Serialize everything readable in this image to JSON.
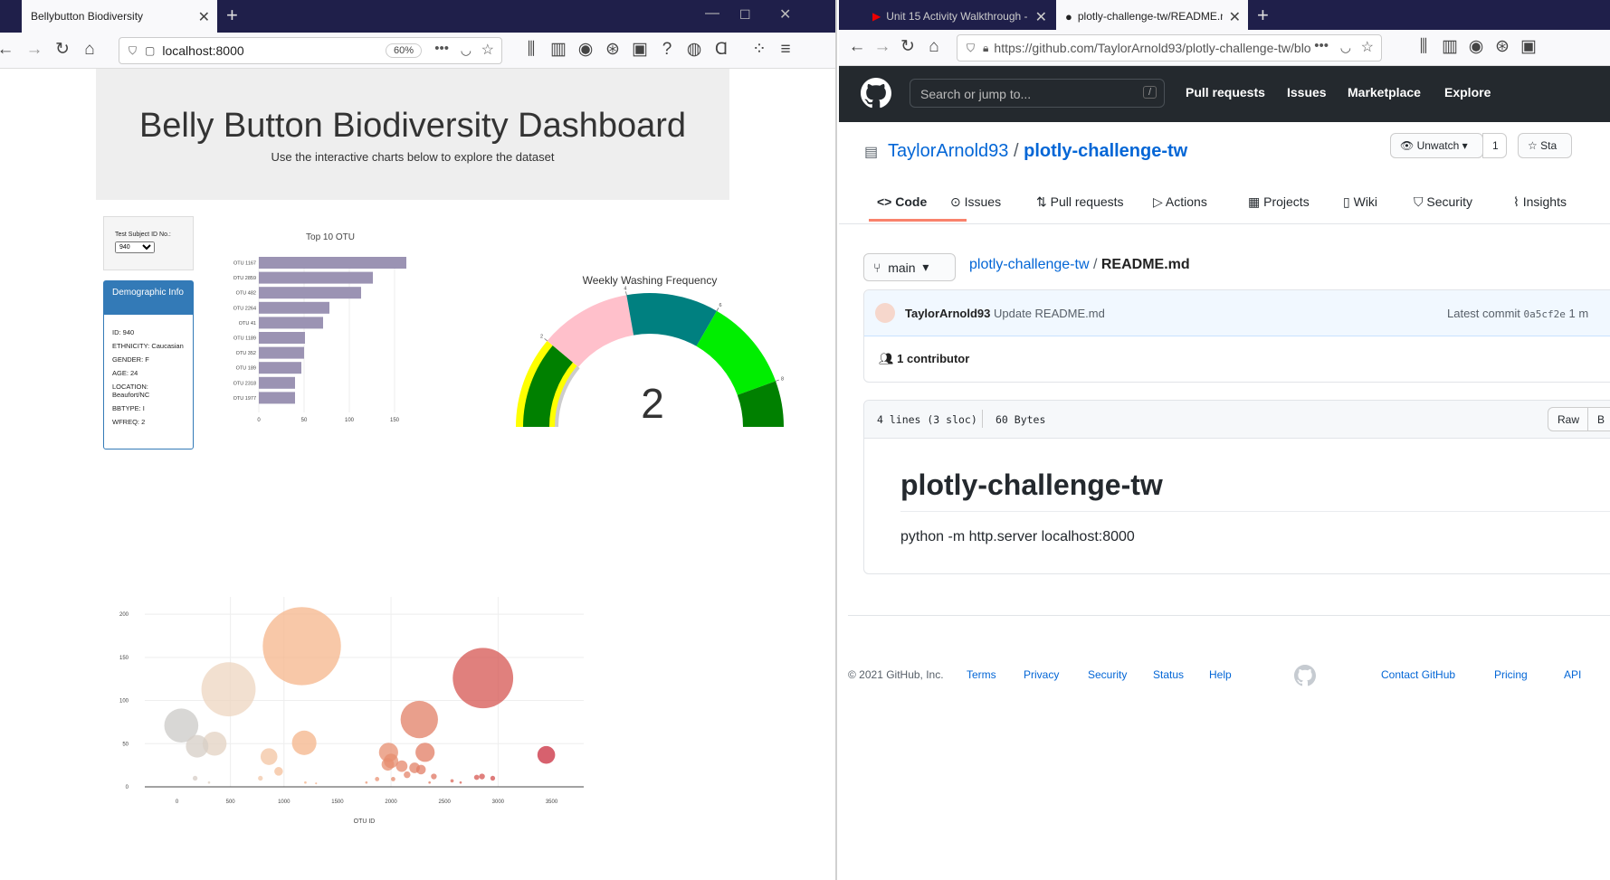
{
  "left_browser": {
    "tab_title": "Bellybutton Biodiversity",
    "url": "localhost:8000",
    "zoom": "60%"
  },
  "dashboard": {
    "title": "Belly Button Biodiversity Dashboard",
    "subtitle": "Use the interactive charts below to explore the dataset",
    "select_label": "Test Subject ID No.:",
    "selected_id": "940",
    "demo_title": "Demographic Info",
    "demographics": [
      "ID: 940",
      "ETHNICITY: Caucasian",
      "GENDER: F",
      "AGE: 24",
      "LOCATION: Beaufort/NC",
      "BBTYPE: I",
      "WFREQ: 2"
    ]
  },
  "chart_data": [
    {
      "type": "bar",
      "orientation": "horizontal",
      "title": "Top 10 OTU",
      "categories": [
        "OTU 1167",
        "OTU 2859",
        "OTU 482",
        "OTU 2264",
        "OTU 41",
        "OTU 1189",
        "OTU 352",
        "OTU 189",
        "OTU 2318",
        "OTU 1977"
      ],
      "values": [
        163,
        126,
        113,
        78,
        71,
        51,
        50,
        47,
        40,
        40
      ],
      "xlim": [
        0,
        175
      ],
      "xticks": [
        0,
        50,
        100,
        150
      ],
      "color": "#9b93b3"
    },
    {
      "type": "gauge",
      "title": "Weekly Washing Frequency",
      "value": 2,
      "range": [
        0,
        9
      ],
      "ticks": [
        0,
        2,
        4,
        6,
        8
      ],
      "bands": [
        {
          "from": 0,
          "to": 2,
          "color": "#008000",
          "border": "#ffff00"
        },
        {
          "from": 2,
          "to": 4,
          "color": "#ffc0cb"
        },
        {
          "from": 4,
          "to": 6,
          "color": "#008080"
        },
        {
          "from": 6,
          "to": 8,
          "color": "#00ee00"
        },
        {
          "from": 8,
          "to": 9,
          "color": "#008000"
        }
      ]
    },
    {
      "type": "scatter",
      "subtype": "bubble",
      "xlabel": "OTU ID",
      "xlim": [
        -300,
        3800
      ],
      "ylim": [
        0,
        220
      ],
      "xticks": [
        0,
        500,
        1000,
        1500,
        2000,
        2500,
        3000,
        3500
      ],
      "yticks": [
        0,
        50,
        100,
        150,
        200
      ],
      "points": [
        {
          "x": 41,
          "y": 71,
          "s": 71
        },
        {
          "x": 189,
          "y": 47,
          "s": 47
        },
        {
          "x": 352,
          "y": 50,
          "s": 50
        },
        {
          "x": 482,
          "y": 113,
          "s": 113
        },
        {
          "x": 1167,
          "y": 163,
          "s": 163
        },
        {
          "x": 1189,
          "y": 51,
          "s": 51
        },
        {
          "x": 2264,
          "y": 78,
          "s": 78
        },
        {
          "x": 2859,
          "y": 126,
          "s": 126
        },
        {
          "x": 2318,
          "y": 40,
          "s": 40
        },
        {
          "x": 1977,
          "y": 40,
          "s": 40
        },
        {
          "x": 3450,
          "y": 37,
          "s": 37
        },
        {
          "x": 860,
          "y": 35,
          "s": 35
        },
        {
          "x": 2000,
          "y": 30,
          "s": 30
        },
        {
          "x": 2100,
          "y": 24,
          "s": 24
        },
        {
          "x": 1970,
          "y": 26,
          "s": 26
        },
        {
          "x": 2220,
          "y": 22,
          "s": 22
        },
        {
          "x": 2280,
          "y": 20,
          "s": 20
        },
        {
          "x": 950,
          "y": 18,
          "s": 18
        },
        {
          "x": 2150,
          "y": 14,
          "s": 14
        },
        {
          "x": 2400,
          "y": 12,
          "s": 12
        },
        {
          "x": 2800,
          "y": 11,
          "s": 11
        },
        {
          "x": 2950,
          "y": 10,
          "s": 10
        },
        {
          "x": 1870,
          "y": 9,
          "s": 9
        },
        {
          "x": 2020,
          "y": 9,
          "s": 9
        },
        {
          "x": 2570,
          "y": 7,
          "s": 7
        },
        {
          "x": 2850,
          "y": 12,
          "s": 12
        },
        {
          "x": 170,
          "y": 10,
          "s": 10
        },
        {
          "x": 780,
          "y": 10,
          "s": 10
        },
        {
          "x": 300,
          "y": 5,
          "s": 5
        },
        {
          "x": 1200,
          "y": 5,
          "s": 5
        },
        {
          "x": 1300,
          "y": 4,
          "s": 4
        },
        {
          "x": 1770,
          "y": 5,
          "s": 5
        },
        {
          "x": 2360,
          "y": 5,
          "s": 5
        },
        {
          "x": 2650,
          "y": 5,
          "s": 5
        }
      ]
    }
  ],
  "right_browser": {
    "tab1_title": "Unit 15 Activity Walkthrough -",
    "tab2_title": "plotly-challenge-tw/README.m",
    "url": "https://github.com/TaylorArnold93/plotly-challenge-tw/blob/"
  },
  "github": {
    "search_placeholder": "Search or jump to...",
    "search_shortcut": "/",
    "nav": [
      "Pull requests",
      "Issues",
      "Marketplace",
      "Explore"
    ],
    "owner": "TaylorArnold93",
    "sep": "/",
    "repo": "plotly-challenge-tw",
    "unwatch": "Unwatch",
    "watch_count": "1",
    "star": "Sta",
    "tabs": [
      "Code",
      "Issues",
      "Pull requests",
      "Actions",
      "Projects",
      "Wiki",
      "Security",
      "Insights"
    ],
    "branch": "main",
    "path_repo": "plotly-challenge-tw",
    "path_file": "README.md",
    "commit_author": "TaylorArnold93",
    "commit_msg": "Update README.md",
    "latest_commit_label": "Latest commit",
    "commit_hash": "0a5cf2e",
    "commit_time": "1 m",
    "contributors": "1 contributor",
    "file_lines": "4 lines (3 sloc)",
    "file_size": "60 Bytes",
    "raw": "Raw",
    "blame_partial": "B",
    "readme_title": "plotly-challenge-tw",
    "readme_body": "python -m http.server localhost:8000",
    "footer_copy": "© 2021 GitHub, Inc.",
    "footer_left": [
      "Terms",
      "Privacy",
      "Security",
      "Status",
      "Help"
    ],
    "footer_right": [
      "Contact GitHub",
      "Pricing",
      "API"
    ]
  }
}
